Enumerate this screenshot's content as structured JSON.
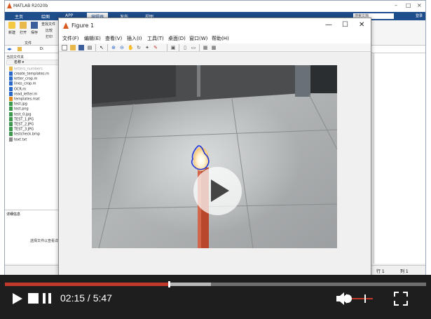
{
  "matlab": {
    "title": "MATLAB R2020b",
    "tabs": [
      "主页",
      "绘图",
      "APP",
      "编辑器",
      "发布",
      "视图"
    ],
    "active_tab": "编辑器",
    "search_placeholder": "搜索文档",
    "login": "登录",
    "ribbon": {
      "new": "新建",
      "open": "打开",
      "save": "保存",
      "find_files": "查找文件",
      "compare": "比较",
      "print": "打印",
      "group_file": "文件"
    },
    "current_folder_title": "当前文件夹",
    "folder_short": "D:",
    "column_name": "名称 ▾",
    "folder_name": "letters_numbers",
    "files": [
      "create_templates.m",
      "letter_crop.m",
      "lines_crop.m",
      "OCR.m",
      "read_letter.m",
      "templates.mat",
      "test.jpg",
      "test.png",
      "test_0.jpg",
      "TEST_1.JPG",
      "TEST_2.JPG",
      "TEST_3.JPG",
      "testcheck.bmp",
      "text.txt"
    ],
    "details_title": "详细信息",
    "details_message": "选择文件以查看详",
    "status_row": "行 1",
    "status_col": "列 1"
  },
  "figure": {
    "title": "Figure 1",
    "menu": [
      "文件(F)",
      "编辑(E)",
      "查看(V)",
      "插入(I)",
      "工具(T)",
      "桌面(D)",
      "窗口(W)",
      "帮助(H)"
    ],
    "window_controls": {
      "minimize": "—",
      "maximize": "☐",
      "close": "✕"
    }
  },
  "player": {
    "current_time": "02:15",
    "duration": "5:47",
    "time_text": "02:15 / 5:47",
    "progress": 0.39,
    "buffered": 0.49,
    "volume": 0.75
  }
}
